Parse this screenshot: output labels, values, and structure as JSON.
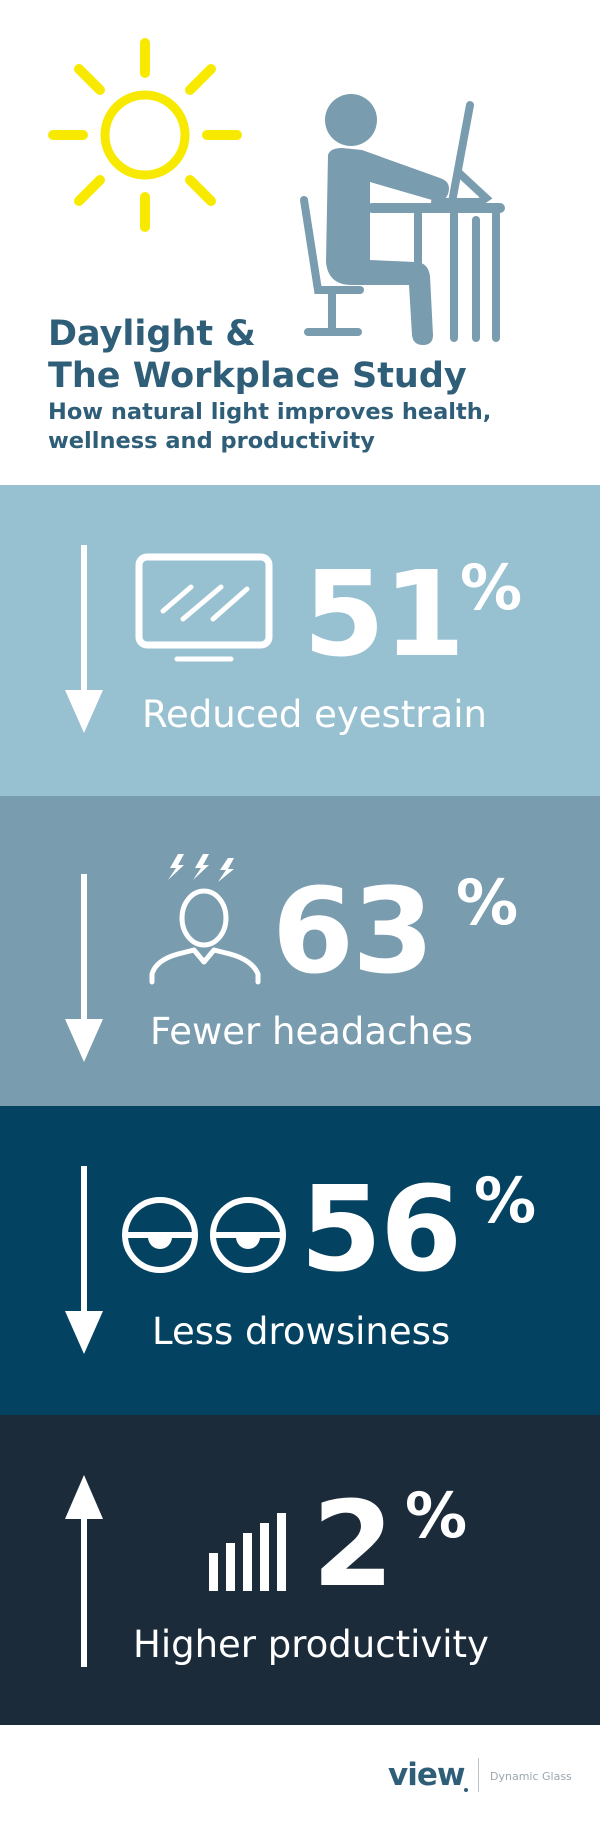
{
  "header": {
    "title_line1": "Daylight &",
    "title_line2": "The Workplace Study",
    "subtitle_line1": "How natural light improves health,",
    "subtitle_line2": "wellness and productivity"
  },
  "stats": [
    {
      "direction": "down",
      "icon": "monitor-icon",
      "value": "51",
      "unit": "%",
      "label": "Reduced eyestrain"
    },
    {
      "direction": "down",
      "icon": "headache-person-icon",
      "value": "63",
      "unit": "%",
      "label": "Fewer headaches"
    },
    {
      "direction": "down",
      "icon": "drowsy-eyes-icon",
      "value": "56",
      "unit": "%",
      "label": "Less drowsiness"
    },
    {
      "direction": "up",
      "icon": "bar-chart-icon",
      "value": "2",
      "unit": "%",
      "label": "Higher productivity"
    }
  ],
  "footer": {
    "logo": "view",
    "tagline": "Dynamic Glass"
  },
  "colors": {
    "sun": "#f7ea00",
    "accent": "#2f5e79",
    "panel_1": "#97c0d1",
    "panel_2": "#7a9caf",
    "panel_3": "#044262",
    "panel_4": "#1c2b3a",
    "icon_grey": "#7a9caf"
  }
}
